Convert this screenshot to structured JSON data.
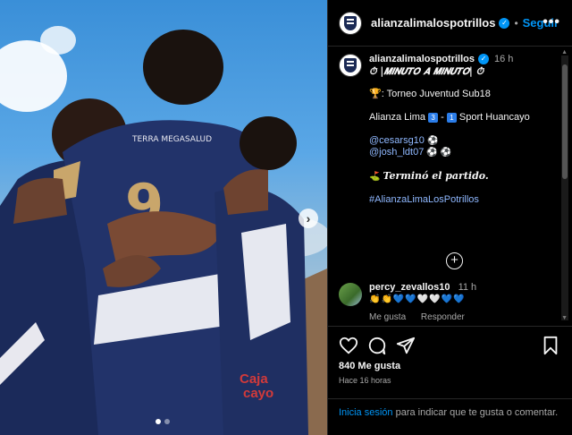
{
  "colors": {
    "accent": "#0095f6",
    "background": "#000000",
    "divider": "#262626",
    "link": "#8fb8ff"
  },
  "header": {
    "username": "alianzalimalospotrillos",
    "separator": "•",
    "follow_label": "Seguir",
    "more_label": "•••"
  },
  "caption": {
    "username": "alianzalimalospotrillos",
    "time": "16 h",
    "line1": "⏱ |𝙈𝙄𝙉𝙐𝙏𝙊 𝘼 𝙈𝙄𝙉𝙐𝙏𝙊| ⏱",
    "line2": "🏆: Torneo Juventud Sub18",
    "line3_team1": "Alianza Lima",
    "line3_score1": "3",
    "line3_dash": "-",
    "line3_score2": "1",
    "line3_team2": "Sport Huancayo",
    "mention1": "@cesarsg10",
    "mention1_emoji": "⚽",
    "mention2": "@josh_ldt07",
    "mention2_emoji": "⚽ ⚽",
    "final_icon": "⛳",
    "final_text": "Terminó el partido.",
    "hashtag": "#AlianzaLimaLosPotrillos"
  },
  "comment": {
    "username": "percy_zevallos10",
    "time": "11 h",
    "emojis": "👏👏💙💙🤍🤍💙💙",
    "like_label": "Me gusta",
    "reply_label": "Responder"
  },
  "actions": {
    "likes": "840 Me gusta",
    "posted": "Hace 16 horas"
  },
  "login": {
    "link": "Inicia sesión",
    "text": " para indicar que te gusta o comentar."
  },
  "photo": {
    "jersey_number": "9",
    "sponsor_text": "Caja\ncayo",
    "sponsor_small": "TERRA MEGASALUD",
    "next_arrow": "›"
  },
  "icons": [
    "verified-icon",
    "more-icon",
    "heart-icon",
    "comment-icon",
    "share-icon",
    "bookmark-icon",
    "add-comment-icon",
    "next-arrow-icon"
  ]
}
